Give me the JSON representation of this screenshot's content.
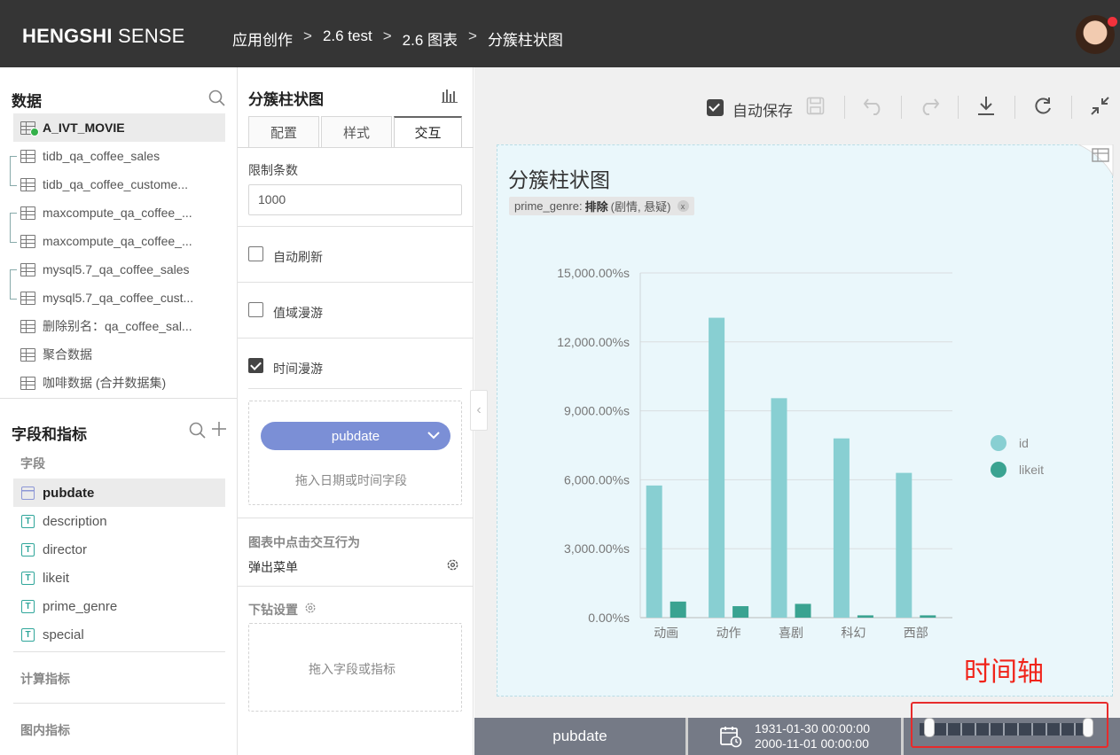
{
  "header": {
    "brand_bold": "HENGSHI",
    "brand_rest": " SENSE",
    "breadcrumbs": [
      "应用创作",
      "2.6 test",
      "2.6 图表",
      "分簇柱状图"
    ]
  },
  "data_panel": {
    "title": "数据",
    "datasets": [
      "A_IVT_MOVIE",
      "tidb_qa_coffee_sales",
      "tidb_qa_coffee_custome...",
      "maxcompute_qa_coffee_...",
      "maxcompute_qa_coffee_...",
      "mysql5.7_qa_coffee_sales",
      "mysql5.7_qa_coffee_cust...",
      "删除别名：qa_coffee_sal...",
      "聚合数据",
      "咖啡数据 (合并数据集)"
    ]
  },
  "fields_panel": {
    "title": "字段和指标",
    "fields_label": "字段",
    "fields": [
      "pubdate",
      "description",
      "director",
      "likeit",
      "prime_genre",
      "special"
    ],
    "calc_label": "计算指标",
    "inchart_label": "图内指标"
  },
  "config_panel": {
    "title": "分簇柱状图",
    "tabs": [
      "配置",
      "样式",
      "交互"
    ],
    "limit_label": "限制条数",
    "limit_value": "1000",
    "auto_refresh": "自动刷新",
    "value_roam": "值域漫游",
    "time_roam": "时间漫游",
    "pill": "pubdate",
    "drop_hint": "拖入日期或时间字段",
    "click_behavior_label": "图表中点击交互行为",
    "click_behavior_value": "弹出菜单",
    "drill_label": "下钻设置",
    "drill_hint": "拖入字段或指标"
  },
  "toolbar": {
    "autosave": "自动保存"
  },
  "chart_card": {
    "title": "分簇柱状图",
    "filter_field": "prime_genre:",
    "filter_op": "排除",
    "filter_values": "(剧情, 悬疑)",
    "filter_close": "x"
  },
  "annotation": "时间轴",
  "bottom": {
    "field": "pubdate",
    "range_start": "1931-01-30 00:00:00",
    "range_end": "2000-11-01 00:00:00"
  },
  "chart_data": {
    "type": "bar",
    "categories": [
      "动画",
      "动作",
      "喜剧",
      "科幻",
      "西部"
    ],
    "series": [
      {
        "name": "id",
        "values": [
          5750,
          13050,
          9550,
          7800,
          6300
        ],
        "color": "#88cfd2"
      },
      {
        "name": "likeit",
        "values": [
          700,
          500,
          600,
          100,
          100
        ],
        "color": "#3aa391"
      }
    ],
    "y_ticks": [
      "0.00%s",
      "3,000.00%s",
      "6,000.00%s",
      "9,000.00%s",
      "12,000.00%s",
      "15,000.00%s"
    ],
    "ylim": [
      0,
      15000
    ],
    "grid": true,
    "legend": "right"
  }
}
